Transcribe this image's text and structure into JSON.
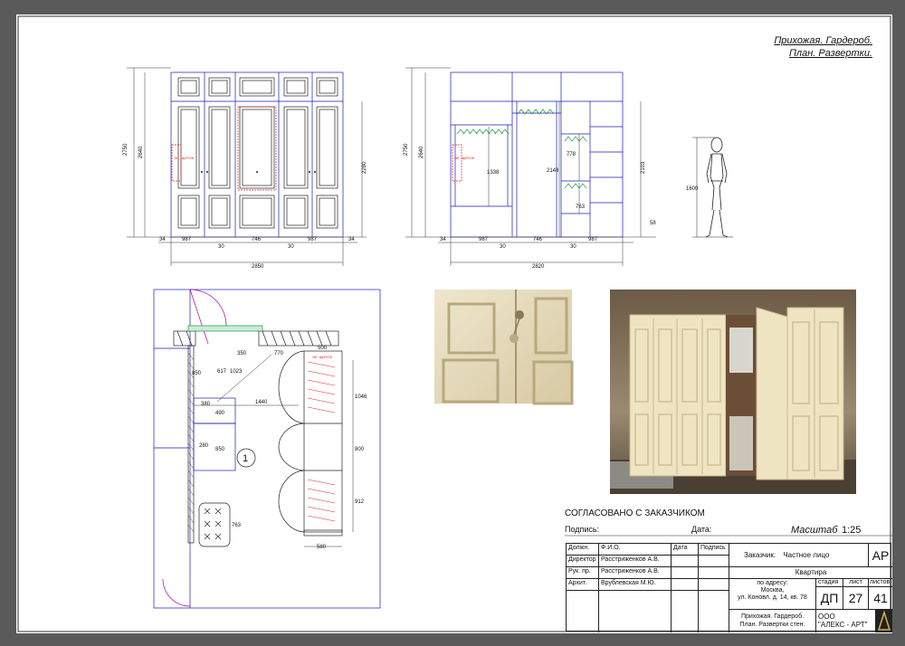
{
  "sheet_title": [
    "Прихожая. Гардероб.",
    "План. Развертки."
  ],
  "elevation_left": {
    "dims_vertical": [
      "2750",
      "2640",
      "2280"
    ],
    "dims_bottom": [
      "34",
      "987",
      "30",
      "746",
      "30",
      "987",
      "34"
    ],
    "total": "2850",
    "tag": "ЭЛ. ЩИТОК"
  },
  "elevation_right": {
    "dims_vertical": [
      "2750",
      "2640",
      "1338",
      "2148",
      "778",
      "763",
      "2103",
      "58"
    ],
    "dims_bottom": [
      "34",
      "987",
      "30",
      "746",
      "30",
      "987"
    ],
    "total": "2820",
    "tag": "ЭЛ. ЩИТОК"
  },
  "figure": {
    "height": "1600"
  },
  "plan": {
    "dims": [
      "850",
      "617",
      "1023",
      "770",
      "350",
      "1046",
      "380",
      "490",
      "1440",
      "850",
      "280",
      "800",
      "912",
      "763",
      "580",
      "500",
      "500"
    ],
    "room_number": "1",
    "tag": "ЭЛ. ЩИТОК"
  },
  "approval": {
    "heading": "СОГЛАСОВАНО С ЗАКАЗЧИКОМ",
    "signature_label": "Подпись:",
    "date_label": "Дата:",
    "scale_label": "Масштаб",
    "scale_value": "1:25"
  },
  "stamp": {
    "headers": [
      "Должн.",
      "Ф.И.О.",
      "Дата",
      "Подпись"
    ],
    "rows": [
      [
        "Директор",
        "Расстриженков А.В."
      ],
      [
        "Рук. пр.",
        "Расстриженков А.В."
      ],
      [
        "Архит.",
        "Врублевская М.Ю."
      ]
    ],
    "client_label": "Заказчик:",
    "client_value": "Частное лицо",
    "type": "АР",
    "object": "Квартира",
    "address": [
      "по адресу:",
      "Москва,",
      "ул. Коновл. д. 14, кв. 78"
    ],
    "stage_label": "стадия",
    "sheet_label": "лист",
    "sheets_label": "листов",
    "stage": "ДП",
    "sheet": "27",
    "sheets": "41",
    "drawing_name": [
      "Прихожая. Гардероб.",
      "План. Развертки стен."
    ],
    "org": [
      "ООО",
      "\"АЛЕКС - АРТ\""
    ]
  }
}
